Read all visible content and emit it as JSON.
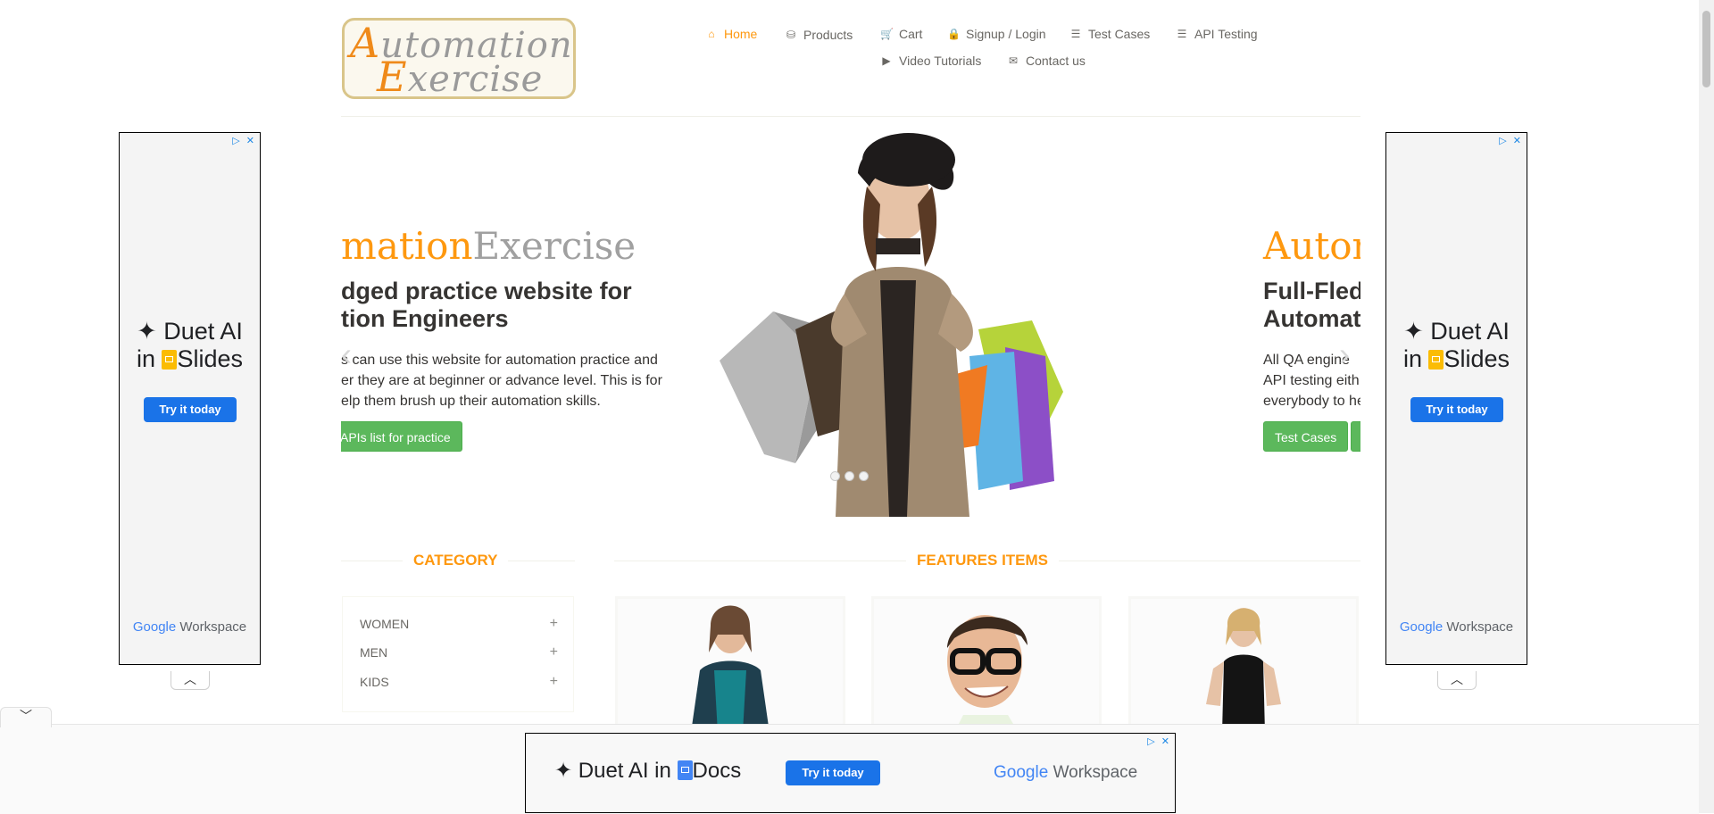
{
  "header": {
    "logo": {
      "line1_cap": "A",
      "line1_rest": "utomation",
      "line2_cap": "E",
      "line2_rest": "xercise"
    },
    "nav": [
      {
        "label": "Home",
        "icon": "home-icon",
        "active": true
      },
      {
        "label": "Products",
        "icon": "products-icon"
      },
      {
        "label": "Cart",
        "icon": "cart-icon"
      },
      {
        "label": "Signup / Login",
        "icon": "lock-icon"
      },
      {
        "label": "Test Cases",
        "icon": "list-icon"
      },
      {
        "label": "API Testing",
        "icon": "list-icon"
      },
      {
        "label": "Video Tutorials",
        "icon": "youtube-icon"
      },
      {
        "label": "Contact us",
        "icon": "envelope-icon"
      }
    ]
  },
  "slider": {
    "slide_left": {
      "brand_orange": "mation",
      "brand_gray": "Exercise",
      "heading_line1": "dged practice website for",
      "heading_line2": "tion Engineers",
      "text_line1": "s can use this website for automation practice and",
      "text_line2": "er they are at beginner or advance level. This is for",
      "text_line3": "elp them brush up their automation skills.",
      "button": "APIs list for practice"
    },
    "slide_right": {
      "brand_orange": "Autom",
      "heading_line1": "Full-Fled",
      "heading_line2": "Automat",
      "text_line1": "All QA engine",
      "text_line2": "API testing eith",
      "text_line3": "everybody to he",
      "button": "Test Cases"
    },
    "prev_arrow": "‹",
    "next_arrow": "›",
    "indicators": 3
  },
  "sidebar": {
    "title": "CATEGORY",
    "categories": [
      {
        "label": "WOMEN"
      },
      {
        "label": "MEN"
      },
      {
        "label": "KIDS"
      }
    ]
  },
  "features": {
    "title": "FEATURES ITEMS"
  },
  "ads": {
    "side": {
      "line1": "✦ Duet AI",
      "line2_pre": "in ",
      "line2_post": "Slides",
      "button": "Try it today",
      "brand_google": "Google",
      "brand_workspace": "Workspace"
    },
    "bottom": {
      "text_pre": "✦ Duet AI in ",
      "text_post": "Docs",
      "button": "Try it today",
      "brand_google": "Google",
      "brand_workspace": "Workspace"
    },
    "collapse_glyph": "︿",
    "expand_glyph": "﹀",
    "close_glyph": "✕",
    "choices_glyph": "▷"
  },
  "colors": {
    "accent": "#fe980f",
    "button_green": "#5cb85c",
    "ad_blue": "#1a73e8"
  }
}
